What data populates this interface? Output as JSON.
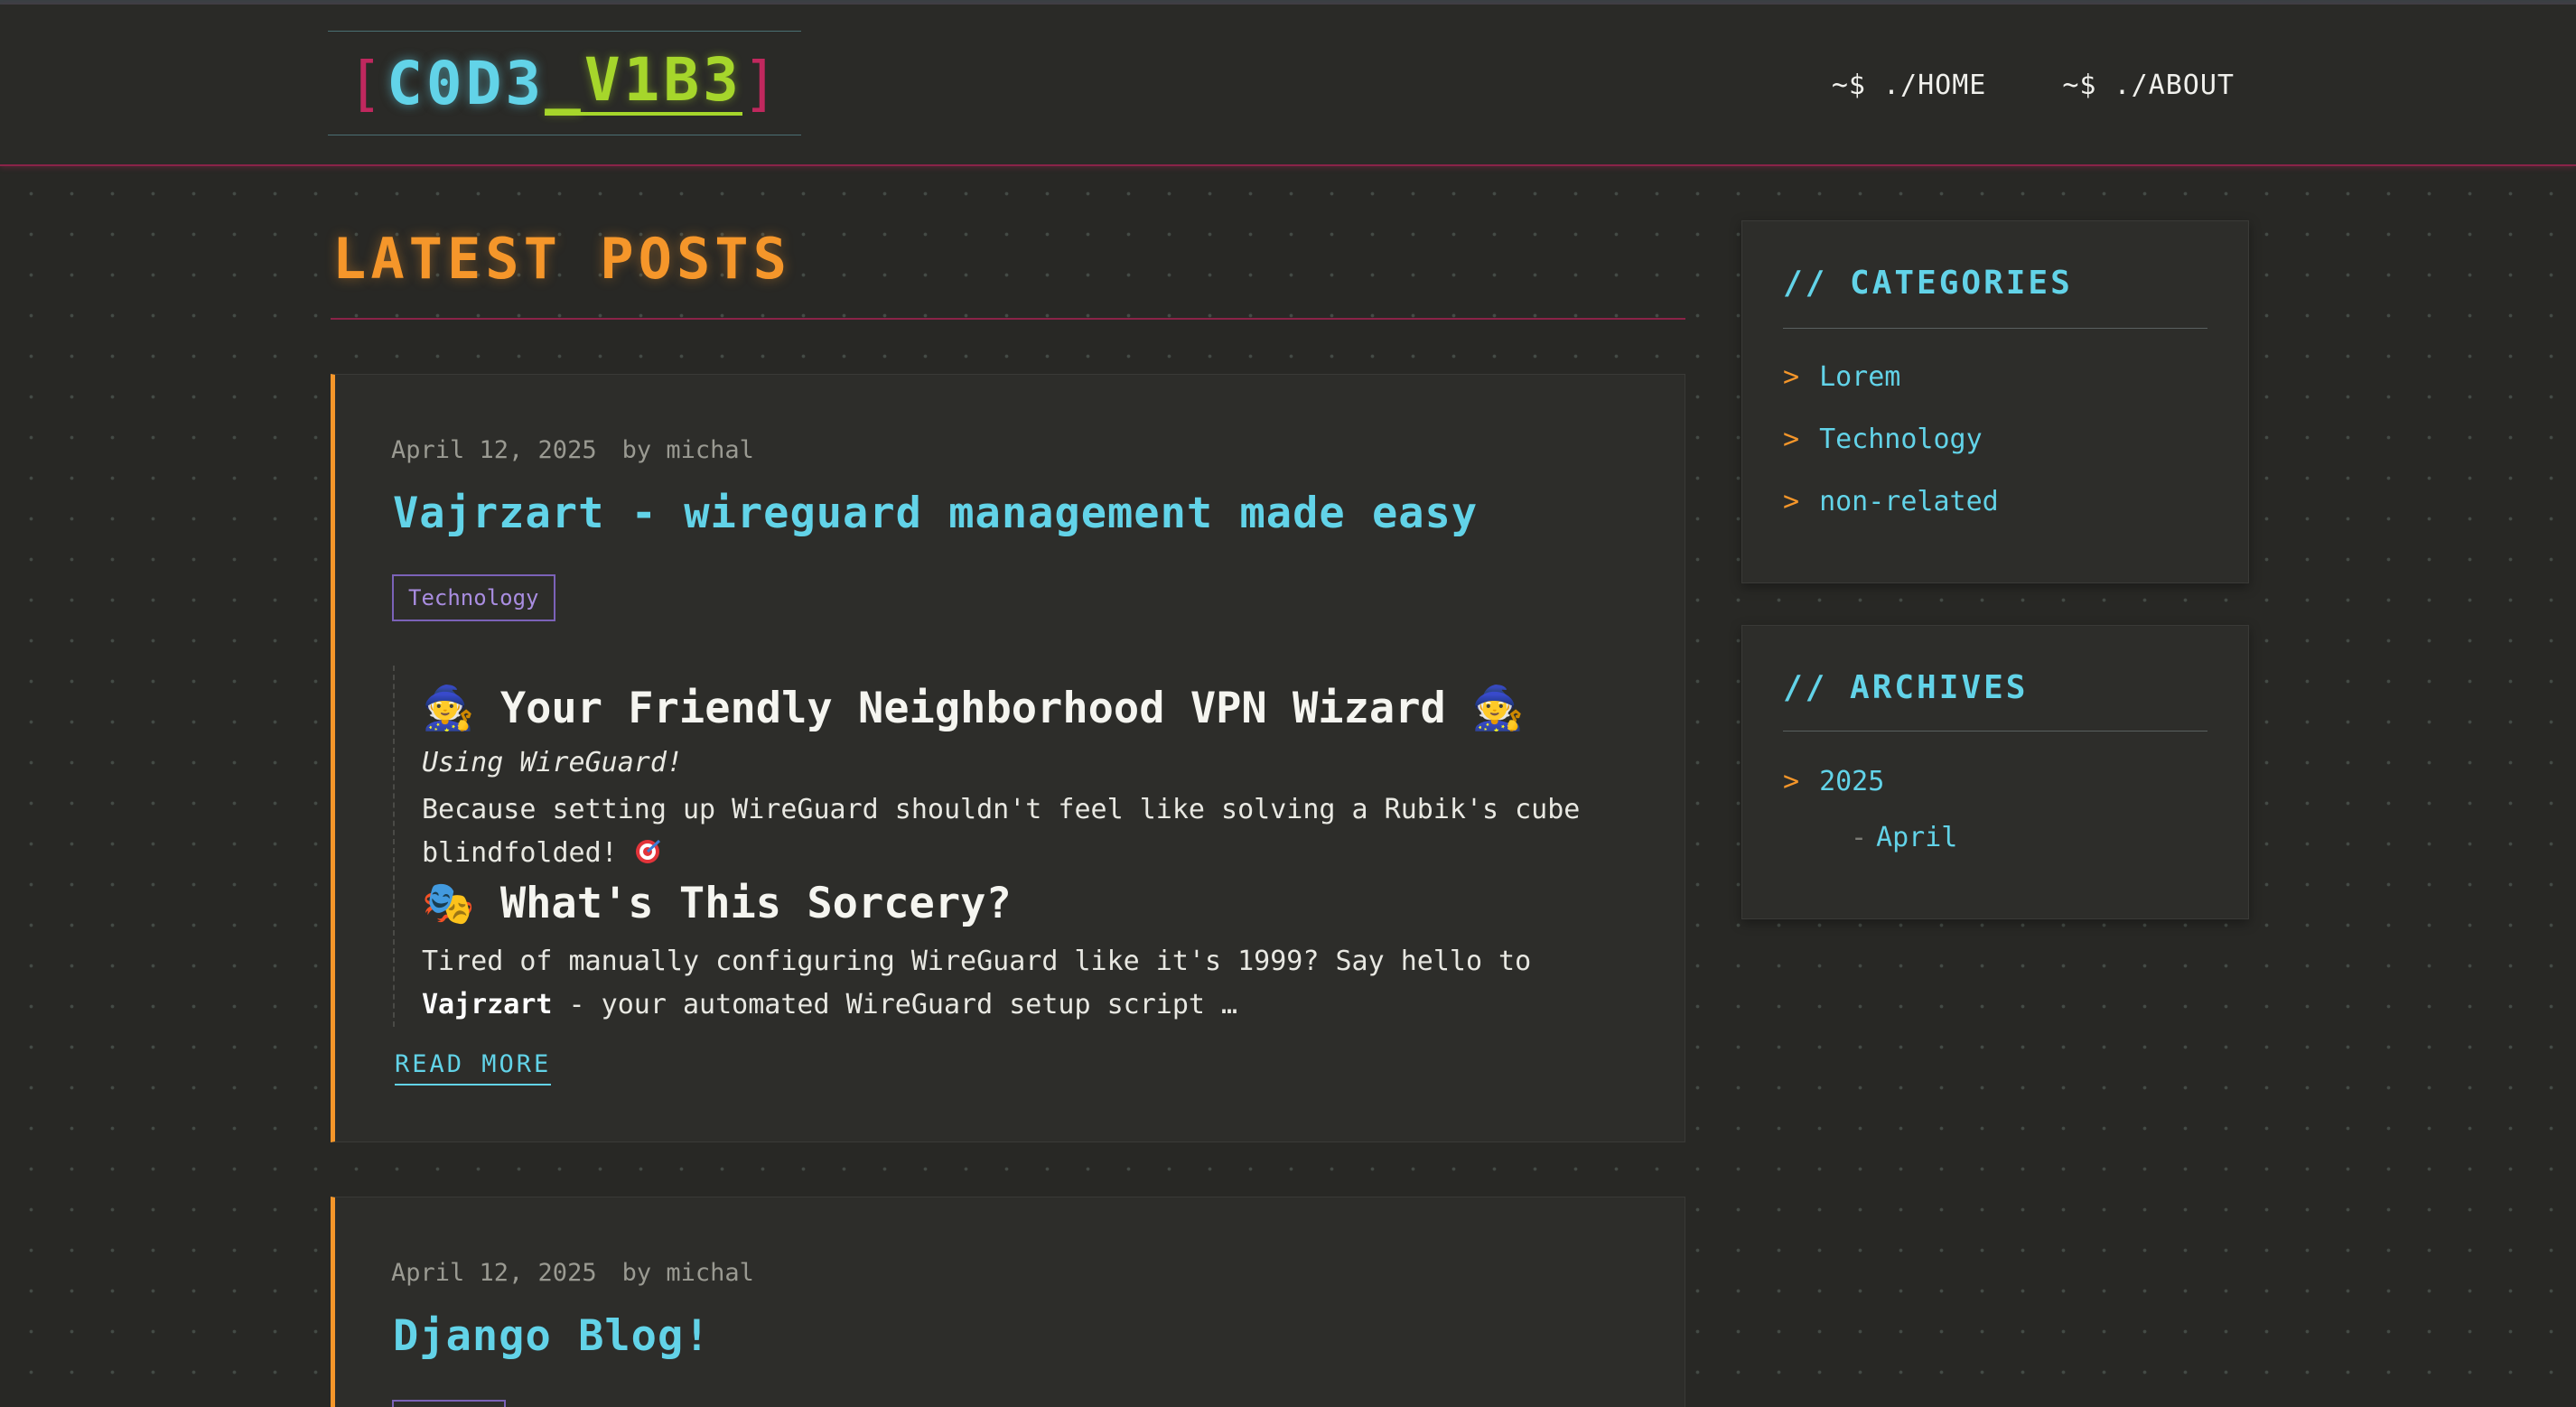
{
  "header": {
    "logo": {
      "bracket_open": "[",
      "part1": "C0D3",
      "part2": "_V1B3",
      "bracket_close": "]"
    },
    "nav": [
      {
        "label": "~$ ./HOME"
      },
      {
        "label": "~$ ./ABOUT"
      }
    ]
  },
  "main": {
    "title": "LATEST POSTS",
    "posts": [
      {
        "date": "April 12, 2025",
        "author": "by michal",
        "title": "Vajrzart - wireguard management made easy",
        "tag": "Technology",
        "excerpt": {
          "heading1": "🧙 Your Friendly Neighborhood VPN Wizard 🧙",
          "subtitle": "Using WireGuard!",
          "para1": "Because setting up WireGuard shouldn't feel like solving a Rubik's cube blindfolded!",
          "heading2": "🎭 What's This Sorcery?",
          "para2_start": "Tired of manually configuring WireGuard like it's 1999? Say hello to",
          "para2_bold": "Vajrzart",
          "para2_end": " - your automated WireGuard setup script …"
        },
        "read_more": "READ MORE"
      },
      {
        "date": "April 12, 2025",
        "author": "by michal",
        "title": "Django Blog!"
      }
    ]
  },
  "sidebar": {
    "categories": {
      "title": "// CATEGORIES",
      "items": [
        {
          "label": "Lorem"
        },
        {
          "label": "Technology"
        },
        {
          "label": "non-related"
        }
      ]
    },
    "archives": {
      "title": "// ARCHIVES",
      "year": "2025",
      "month_prefix": "-",
      "month": "April"
    },
    "caret": ">"
  },
  "colors": {
    "background": "#282825",
    "accent_orange": "#f5962a",
    "accent_cyan": "#62d3e8",
    "accent_green": "#a6d62b",
    "accent_magenta": "#c0285e",
    "tag_purple": "#a98de0"
  },
  "icons": {
    "target": "target-emoji-icon"
  }
}
